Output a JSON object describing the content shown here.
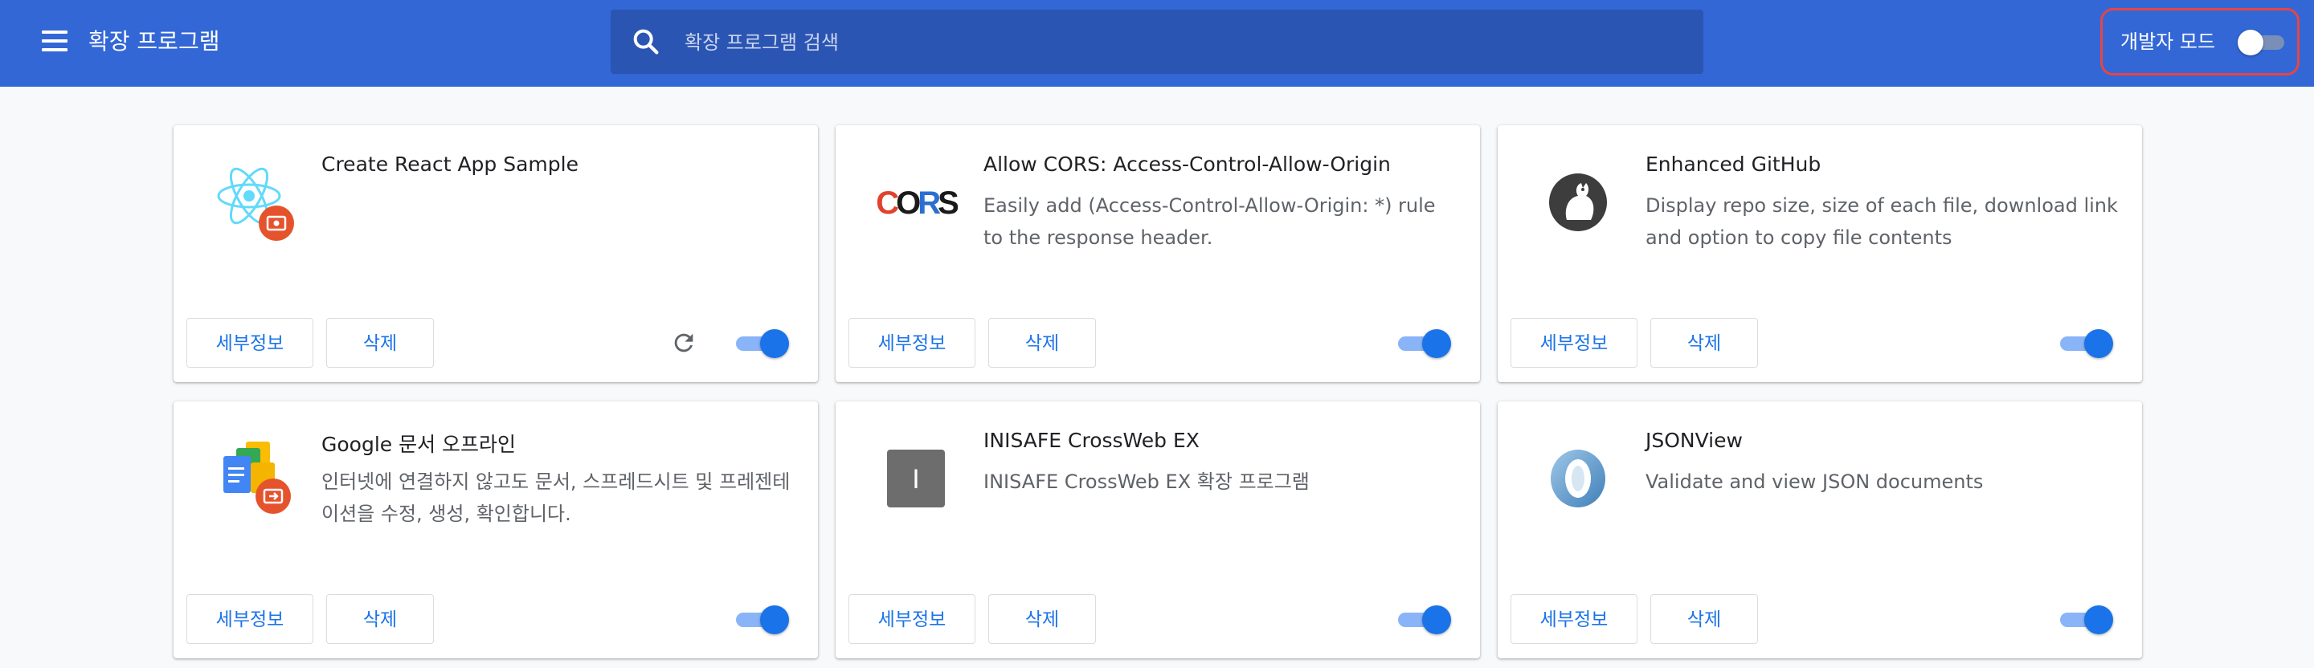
{
  "header": {
    "title": "확장 프로그램",
    "search_placeholder": "확장 프로그램 검색",
    "dev_mode_label": "개발자 모드",
    "dev_mode_enabled": false
  },
  "buttons": {
    "details": "세부정보",
    "remove": "삭제"
  },
  "extensions": [
    {
      "name": "Create React App Sample",
      "description": "",
      "icon": "react-icon",
      "enabled": true,
      "reload": true
    },
    {
      "name": "Allow CORS: Access-Control-Allow-Origin",
      "description": "Easily add (Access-Control-Allow-Origin: *) rule to the response header.",
      "icon": "cors-icon",
      "enabled": true
    },
    {
      "name": "Enhanced GitHub",
      "description": "Display repo size, size of each file, download link and option to copy file contents",
      "icon": "enhanced-github-icon",
      "enabled": true
    },
    {
      "name": "Google 문서 오프라인",
      "description": "인터넷에 연결하지 않고도 문서, 스프레드시트 및 프레젠테이션을 수정, 생성, 확인합니다.",
      "icon": "google-docs-icon",
      "enabled": true
    },
    {
      "name": "INISAFE CrossWeb EX",
      "description": "INISAFE CrossWeb EX 확장 프로그램",
      "icon": "inisafe-icon",
      "icon_text": "I",
      "enabled": true
    },
    {
      "name": "JSONView",
      "description": "Validate and view JSON documents",
      "icon": "jsonview-icon",
      "enabled": true
    }
  ]
}
